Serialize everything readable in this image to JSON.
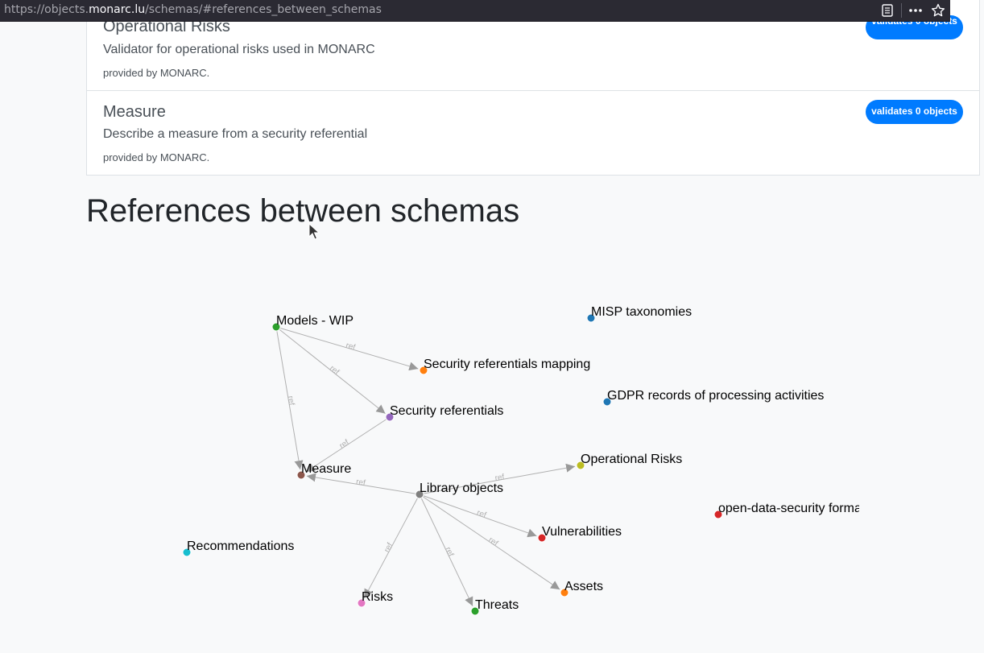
{
  "browser": {
    "url_scheme": "https://objects.",
    "url_host": "monarc.lu",
    "url_path": "/schemas/#references_between_schemas"
  },
  "cards": [
    {
      "title": "Operational Risks",
      "description": "Validator for operational risks used in MONARC",
      "provider": "provided by MONARC.",
      "badge": "validates 0 objects"
    },
    {
      "title": "Measure",
      "description": "Describe a measure from a security referential",
      "provider": "provided by MONARC.",
      "badge": "validates 0 objects"
    }
  ],
  "section_heading": "References between schemas",
  "graph": {
    "edge_label": "ref",
    "nodes": [
      {
        "id": "models",
        "label": "Models - WIP",
        "color": "#2ca02c"
      },
      {
        "id": "srm",
        "label": "Security referentials mapping",
        "color": "#ff7f0e"
      },
      {
        "id": "sr",
        "label": "Security referentials",
        "color": "#9467bd"
      },
      {
        "id": "measure",
        "label": "Measure",
        "color": "#8c564b"
      },
      {
        "id": "lib",
        "label": "Library objects",
        "color": "#7f7f7f"
      },
      {
        "id": "oprisk",
        "label": "Operational Risks",
        "color": "#bcbd22"
      },
      {
        "id": "vuln",
        "label": "Vulnerabilities",
        "color": "#d62728"
      },
      {
        "id": "assets",
        "label": "Assets",
        "color": "#ff7f0e"
      },
      {
        "id": "threats",
        "label": "Threats",
        "color": "#2ca02c"
      },
      {
        "id": "risks",
        "label": "Risks",
        "color": "#e377c2"
      },
      {
        "id": "reco",
        "label": "Recommendations",
        "color": "#17becf"
      },
      {
        "id": "misp",
        "label": "MISP taxonomies",
        "color": "#1f77b4"
      },
      {
        "id": "gdpr",
        "label": "GDPR records of processing activities",
        "color": "#1f77b4"
      },
      {
        "id": "ods",
        "label": "open-data-security format",
        "color": "#d62728"
      }
    ],
    "edges": [
      {
        "from": "models",
        "to": "srm"
      },
      {
        "from": "models",
        "to": "sr"
      },
      {
        "from": "models",
        "to": "measure"
      },
      {
        "from": "sr",
        "to": "measure"
      },
      {
        "from": "lib",
        "to": "measure"
      },
      {
        "from": "lib",
        "to": "oprisk"
      },
      {
        "from": "lib",
        "to": "vuln"
      },
      {
        "from": "lib",
        "to": "assets"
      },
      {
        "from": "lib",
        "to": "threats"
      },
      {
        "from": "lib",
        "to": "risks"
      }
    ]
  }
}
